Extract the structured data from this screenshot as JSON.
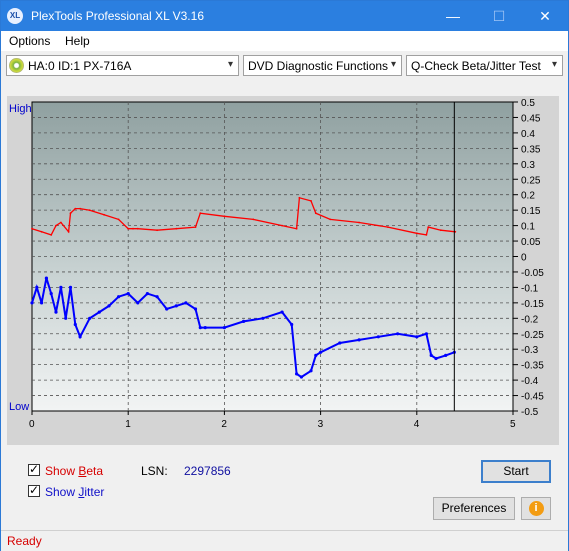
{
  "window": {
    "title": "PlexTools Professional XL V3.16",
    "icon": "XL"
  },
  "titlebar": {
    "min_glyph": "—",
    "max_glyph": "☐",
    "close_glyph": "✕"
  },
  "menu": {
    "items": [
      "Options",
      "Help"
    ]
  },
  "toolbar": {
    "drive": "HA:0 ID:1  PX-716A",
    "function": "DVD Diagnostic Functions",
    "test": "Q-Check Beta/Jitter Test",
    "arrow": "▾"
  },
  "chart": {
    "left_top_label": "High",
    "left_bottom_label": "Low",
    "colors": {
      "beta": "#ff0000",
      "jitter": "#0000ff",
      "axis_label": "#0000cc"
    }
  },
  "chart_data": {
    "type": "line",
    "xlim": [
      0,
      5
    ],
    "ylim": [
      -0.5,
      0.5
    ],
    "x_ticks": [
      "0",
      "1",
      "2",
      "3",
      "4",
      "5"
    ],
    "y_ticks": [
      "0.5",
      "0.45",
      "0.4",
      "0.35",
      "0.3",
      "0.25",
      "0.2",
      "0.15",
      "0.1",
      "0.05",
      "0",
      "-0.05",
      "-0.1",
      "-0.15",
      "-0.2",
      "-0.25",
      "-0.3",
      "-0.35",
      "-0.4",
      "-0.45",
      "-0.5"
    ],
    "grid": true,
    "marker_x": 4.39,
    "series": [
      {
        "name": "Beta",
        "x": [
          0,
          0.1,
          0.2,
          0.25,
          0.3,
          0.38,
          0.4,
          0.45,
          0.5,
          0.6,
          0.75,
          0.9,
          1.0,
          1.05,
          1.1,
          1.3,
          1.5,
          1.7,
          1.75,
          2.0,
          2.3,
          2.6,
          2.75,
          2.78,
          2.9,
          2.95,
          3.1,
          3.4,
          3.7,
          4.0,
          4.1,
          4.12,
          4.25,
          4.4
        ],
        "values": [
          0.09,
          0.08,
          0.07,
          0.1,
          0.11,
          0.08,
          0.14,
          0.155,
          0.155,
          0.15,
          0.135,
          0.12,
          0.09,
          0.09,
          0.09,
          0.085,
          0.09,
          0.095,
          0.14,
          0.13,
          0.12,
          0.1,
          0.09,
          0.19,
          0.18,
          0.14,
          0.12,
          0.11,
          0.095,
          0.075,
          0.07,
          0.095,
          0.085,
          0.08
        ]
      },
      {
        "name": "Jitter",
        "x": [
          0,
          0.05,
          0.1,
          0.15,
          0.2,
          0.25,
          0.3,
          0.35,
          0.4,
          0.45,
          0.5,
          0.6,
          0.7,
          0.8,
          0.9,
          1.0,
          1.1,
          1.2,
          1.3,
          1.4,
          1.5,
          1.6,
          1.7,
          1.75,
          1.8,
          2.0,
          2.2,
          2.4,
          2.6,
          2.7,
          2.75,
          2.8,
          2.9,
          2.95,
          3.0,
          3.2,
          3.4,
          3.6,
          3.8,
          4.0,
          4.1,
          4.15,
          4.2,
          4.3,
          4.39
        ],
        "values": [
          -0.15,
          -0.1,
          -0.15,
          -0.07,
          -0.12,
          -0.18,
          -0.1,
          -0.2,
          -0.1,
          -0.22,
          -0.26,
          -0.2,
          -0.18,
          -0.16,
          -0.13,
          -0.12,
          -0.15,
          -0.12,
          -0.13,
          -0.17,
          -0.16,
          -0.15,
          -0.17,
          -0.23,
          -0.23,
          -0.23,
          -0.21,
          -0.2,
          -0.18,
          -0.22,
          -0.38,
          -0.39,
          -0.37,
          -0.32,
          -0.31,
          -0.28,
          -0.27,
          -0.26,
          -0.25,
          -0.26,
          -0.25,
          -0.32,
          -0.33,
          -0.32,
          -0.31
        ]
      }
    ]
  },
  "controls": {
    "show_beta": {
      "label_pre": "Show ",
      "label_ul": "B",
      "label_post": "eta",
      "checked": true,
      "mark": "✓"
    },
    "show_jitter": {
      "label_pre": "Show ",
      "label_ul": "J",
      "label_post": "itter",
      "checked": true,
      "mark": "✓"
    },
    "lsn_label": "LSN:",
    "lsn_value": "2297856",
    "start_button": "Start",
    "preferences_button": "Preferences",
    "info_glyph": "i"
  },
  "status": {
    "text": "Ready"
  }
}
